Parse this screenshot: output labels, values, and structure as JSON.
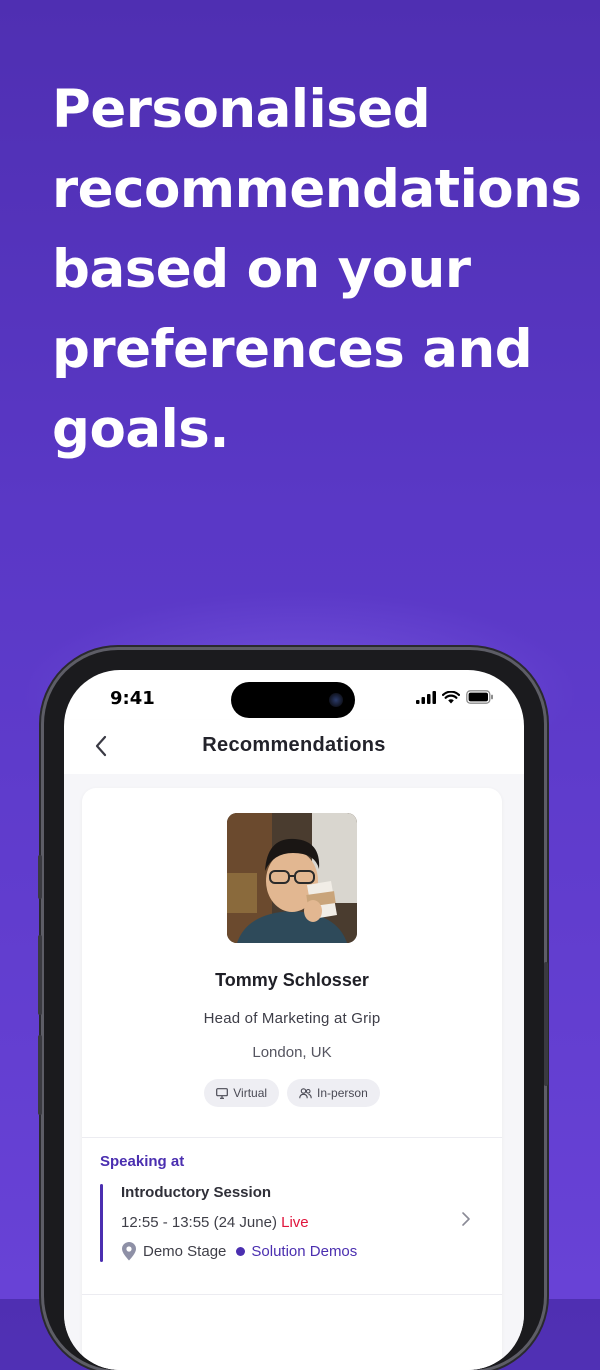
{
  "headline": "Personalised recommendations based on your preferences and goals.",
  "status_bar": {
    "time": "9:41"
  },
  "nav": {
    "title": "Recommendations"
  },
  "speaker": {
    "name": "Tommy Schlosser",
    "role": "Head of Marketing at Grip",
    "location": "London, UK",
    "tags": [
      {
        "icon": "monitor-icon",
        "label": "Virtual"
      },
      {
        "icon": "people-icon",
        "label": "In-person"
      }
    ]
  },
  "speaking_at": {
    "label": "Speaking at",
    "session": {
      "title": "Introductory Session",
      "time": "12:55 - 13:55 (24 June)",
      "status": "Live",
      "location": "Demo Stage",
      "track": "Solution Demos"
    }
  },
  "colors": {
    "accent": "#4b2fb0",
    "live": "#e0143c",
    "background": "#5a38c6"
  }
}
